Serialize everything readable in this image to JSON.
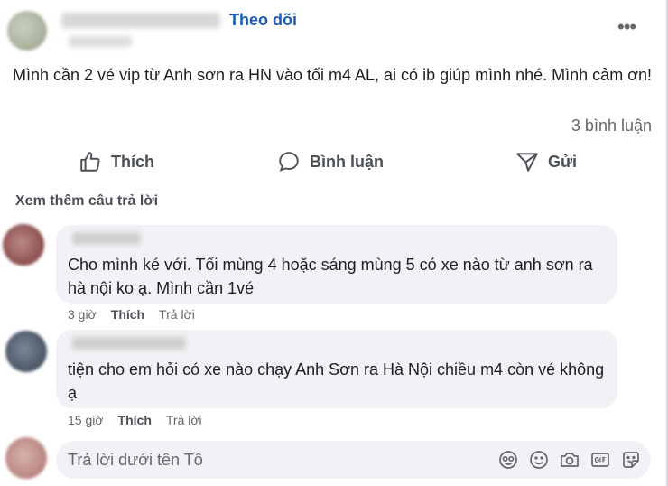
{
  "post": {
    "follow_label": "Theo dõi",
    "more_label": "•••",
    "text": "Mình cần 2 vé vip từ Anh sơn ra HN vào tối m4 AL, ai có ib giúp mình nhé. Mình cảm ơn!",
    "comment_count": "3 bình luận"
  },
  "actions": {
    "like": "Thích",
    "comment": "Bình luận",
    "send": "Gửi"
  },
  "comments": {
    "see_more": "Xem thêm câu trả lời",
    "items": [
      {
        "text": "Cho mình ké với. Tối mùng 4 hoặc sáng mùng 5 có xe nào từ anh sơn ra hà nội ko ạ. Mình cần 1vé",
        "time": "3 giờ",
        "like": "Thích",
        "reply": "Trả lời"
      },
      {
        "text": "tiện cho em hỏi có xe nào chạy Anh Sơn ra Hà Nội chiều m4 còn vé không ạ",
        "time": "15 giờ",
        "like": "Thích",
        "reply": "Trả lời"
      }
    ]
  },
  "reply_box": {
    "placeholder": "Trả lời dưới tên Tô",
    "icons": [
      "avatar-sticker-icon",
      "smiley-icon",
      "camera-icon",
      "gif-icon",
      "sticker-icon"
    ]
  }
}
